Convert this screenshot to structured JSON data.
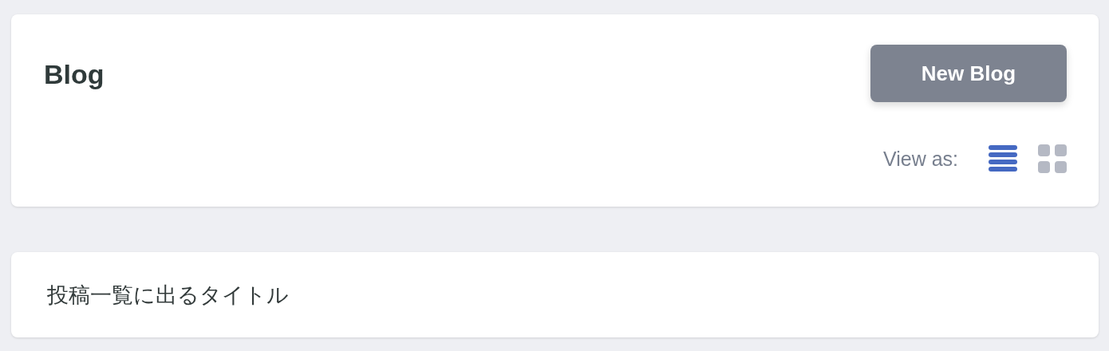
{
  "header": {
    "title": "Blog",
    "new_button": "New Blog",
    "view_label": "View as:",
    "views": [
      {
        "kind": "list",
        "selected": true
      },
      {
        "kind": "grid",
        "selected": false
      }
    ]
  },
  "posts": [
    {
      "title": "投稿一覧に出るタイトル"
    }
  ]
}
